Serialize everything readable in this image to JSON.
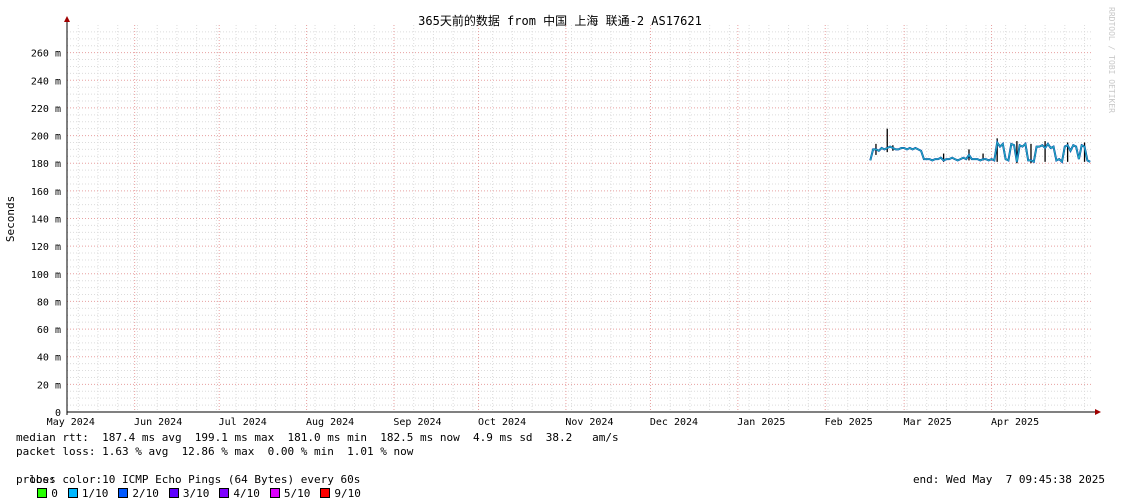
{
  "chart_data": {
    "type": "line",
    "title": "365天前的数据 from 中国 上海 联通-2 AS17621",
    "ylabel": "Seconds",
    "watermark": "RRDTOOL / TOBI OETIKER",
    "ylim": [
      0,
      280
    ],
    "grid": true,
    "yticks": [
      {
        "v": 0,
        "label": "0"
      },
      {
        "v": 20,
        "label": "20 m"
      },
      {
        "v": 40,
        "label": "40 m"
      },
      {
        "v": 60,
        "label": "60 m"
      },
      {
        "v": 80,
        "label": "80 m"
      },
      {
        "v": 100,
        "label": "100 m"
      },
      {
        "v": 120,
        "label": "120 m"
      },
      {
        "v": 140,
        "label": "140 m"
      },
      {
        "v": 160,
        "label": "160 m"
      },
      {
        "v": 180,
        "label": "180 m"
      },
      {
        "v": 200,
        "label": "200 m"
      },
      {
        "v": 220,
        "label": "220 m"
      },
      {
        "v": 240,
        "label": "240 m"
      },
      {
        "v": 260,
        "label": "260 m"
      }
    ],
    "xlim": [
      "2024-05-08",
      "2025-05-07"
    ],
    "xticks": [
      {
        "d": "2024-05-01",
        "label": "May 2024"
      },
      {
        "d": "2024-06-01",
        "label": "Jun 2024"
      },
      {
        "d": "2024-07-01",
        "label": "Jul 2024"
      },
      {
        "d": "2024-08-01",
        "label": "Aug 2024"
      },
      {
        "d": "2024-09-01",
        "label": "Sep 2024"
      },
      {
        "d": "2024-10-01",
        "label": "Oct 2024"
      },
      {
        "d": "2024-11-01",
        "label": "Nov 2024"
      },
      {
        "d": "2024-12-01",
        "label": "Dec 2024"
      },
      {
        "d": "2025-01-01",
        "label": "Jan 2025"
      },
      {
        "d": "2025-02-01",
        "label": "Feb 2025"
      },
      {
        "d": "2025-03-01",
        "label": "Mar 2025"
      },
      {
        "d": "2025-04-01",
        "label": "Apr 2025"
      }
    ],
    "median_color": "#0044aa",
    "loss0_color": "#26b5c0",
    "spike_color": "#000000",
    "series": [
      {
        "x": [
          "2025-02-17",
          "2025-02-18",
          "2025-02-19",
          "2025-02-20",
          "2025-02-21",
          "2025-02-22",
          "2025-02-23",
          "2025-02-24",
          "2025-02-25",
          "2025-02-26",
          "2025-02-27",
          "2025-02-28",
          "2025-03-01",
          "2025-03-02",
          "2025-03-03",
          "2025-03-04",
          "2025-03-05",
          "2025-03-06",
          "2025-03-07",
          "2025-03-08",
          "2025-03-09",
          "2025-03-10",
          "2025-03-11",
          "2025-03-12",
          "2025-03-13",
          "2025-03-14",
          "2025-03-15",
          "2025-03-16",
          "2025-03-17",
          "2025-03-18",
          "2025-03-19",
          "2025-03-20",
          "2025-03-21",
          "2025-03-22",
          "2025-03-23",
          "2025-03-24",
          "2025-03-25",
          "2025-03-26",
          "2025-03-27",
          "2025-03-28",
          "2025-03-29",
          "2025-03-30",
          "2025-03-31",
          "2025-04-01",
          "2025-04-02",
          "2025-04-03",
          "2025-04-04",
          "2025-04-05",
          "2025-04-06",
          "2025-04-07",
          "2025-04-08",
          "2025-04-09",
          "2025-04-10",
          "2025-04-11",
          "2025-04-12",
          "2025-04-13",
          "2025-04-14",
          "2025-04-15",
          "2025-04-16",
          "2025-04-17",
          "2025-04-18",
          "2025-04-19",
          "2025-04-20",
          "2025-04-21",
          "2025-04-22",
          "2025-04-23",
          "2025-04-24",
          "2025-04-25",
          "2025-04-26",
          "2025-04-27",
          "2025-04-28",
          "2025-04-29",
          "2025-04-30",
          "2025-05-01",
          "2025-05-02",
          "2025-05-03",
          "2025-05-04",
          "2025-05-05",
          "2025-05-06"
        ],
        "values": [
          182,
          190,
          190,
          189,
          191,
          190,
          191,
          192,
          191,
          190,
          190,
          191,
          191,
          190,
          191,
          190,
          191,
          190,
          189,
          183,
          183,
          183,
          182,
          183,
          183,
          184,
          182,
          183,
          183,
          184,
          183,
          182,
          183,
          184,
          183,
          186,
          183,
          183,
          183,
          182,
          183,
          183,
          182,
          183,
          182,
          195,
          192,
          194,
          183,
          182,
          194,
          193,
          181,
          193,
          192,
          194,
          182,
          182,
          181,
          192,
          192,
          193,
          191,
          194,
          191,
          192,
          182,
          183,
          181,
          192,
          193,
          189,
          193,
          192,
          183,
          193,
          192,
          182,
          181
        ]
      }
    ],
    "spikes": [
      {
        "x": "2025-02-19",
        "lo": 186,
        "hi": 194
      },
      {
        "x": "2025-02-23",
        "lo": 188,
        "hi": 205
      },
      {
        "x": "2025-02-25",
        "lo": 189,
        "hi": 193
      },
      {
        "x": "2025-03-15",
        "lo": 181,
        "hi": 187
      },
      {
        "x": "2025-03-24",
        "lo": 182,
        "hi": 190
      },
      {
        "x": "2025-03-29",
        "lo": 182,
        "hi": 187
      },
      {
        "x": "2025-04-03",
        "lo": 181,
        "hi": 198
      },
      {
        "x": "2025-04-10",
        "lo": 180,
        "hi": 196
      },
      {
        "x": "2025-04-15",
        "lo": 180,
        "hi": 194
      },
      {
        "x": "2025-04-20",
        "lo": 181,
        "hi": 196
      },
      {
        "x": "2025-04-28",
        "lo": 181,
        "hi": 195
      },
      {
        "x": "2025-05-04",
        "lo": 181,
        "hi": 195
      }
    ]
  },
  "legend": {
    "median_rtt": "median rtt:  187.4 ms avg  199.1 ms max  181.0 ms min  182.5 ms now  4.9 ms sd  38.2   am/s",
    "packet_loss": "packet loss: 1.63 % avg  12.86 % max  0.00 % min  1.01 % now",
    "loss_color_label": "loss color:",
    "loss_colors": [
      {
        "label": "0",
        "color": "#26ff00"
      },
      {
        "label": "1/10",
        "color": "#00b8ff"
      },
      {
        "label": "2/10",
        "color": "#0059ff"
      },
      {
        "label": "3/10",
        "color": "#5e00ff"
      },
      {
        "label": "4/10",
        "color": "#7e00ff"
      },
      {
        "label": "5/10",
        "color": "#dd00ff"
      },
      {
        "label": "9/10",
        "color": "#ff0000"
      }
    ],
    "probe": "probe:       10 ICMP Echo Pings (64 Bytes) every 60s",
    "end": "end: Wed May  7 09:45:38 2025"
  }
}
